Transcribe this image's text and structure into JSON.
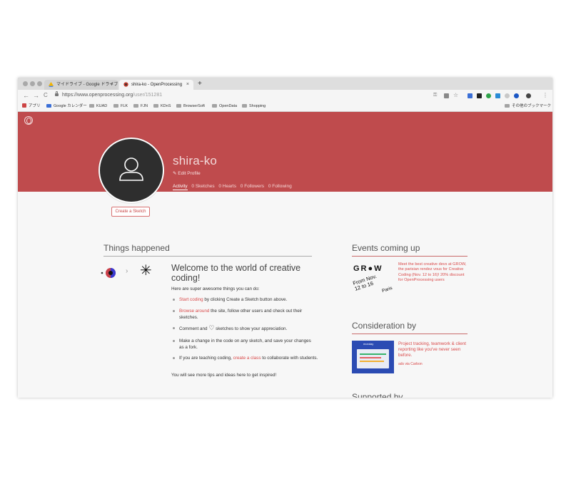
{
  "browser": {
    "tabs": [
      {
        "label": "マイドライブ - Google ドライブ",
        "close": "×"
      },
      {
        "label": "shira-ko - OpenProcessing",
        "close": "×"
      }
    ],
    "new_tab": "+",
    "nav": {
      "back": "←",
      "forward": "→",
      "reload": "C"
    },
    "url_main": "https://www.openprocessing.org",
    "url_path": "/user/151281",
    "bookmarks": [
      "アプリ",
      "Google カレンダー",
      "KUAD",
      "FLK",
      "FJN",
      "KDnS",
      "BrowserSoft",
      "OpenData",
      "Shopping"
    ],
    "bookmarks_other": "その他のブックマーク"
  },
  "profile": {
    "username": "shira-ko",
    "edit_label": "Edit Profile",
    "tabs": [
      "Activity",
      "0 Sketches",
      "0 Hearts",
      "0 Followers",
      "0 Following"
    ],
    "create_button": "Create a Sketch"
  },
  "activity": {
    "heading": "Things happened",
    "arrow": "›",
    "star": "✳",
    "welcome_title": "Welcome to the world of creative coding!",
    "intro": "Here are super awesome things you can do:",
    "items": [
      {
        "link": "Start coding",
        "rest": " by clicking Create a Sketch button above."
      },
      {
        "link": "Browse around",
        "rest": " the site, follow other users and check out their sketches."
      },
      {
        "pre": "Comment and ",
        "heart": "♡",
        "rest": " sketches to show your appreciation."
      },
      {
        "text": "Make a change in the code on any sketch, and save your changes as a fork."
      },
      {
        "pre": "If you are teaching coding, ",
        "link": "create a class",
        "rest": " to collaborate with students."
      }
    ],
    "outro": "You will see more tips and ideas here to get inspired!"
  },
  "sidebar": {
    "events_heading": "Events coming up",
    "event": {
      "logo_word": "GR●W",
      "logo_dates": "From Nov. 12 to 16",
      "logo_city": "Paris",
      "text": "Meet the best creative devs at GROW, the parisian rendez vous for Creative Coding (Nov. 12 to 16)! 20% discount for OpenProcessing users"
    },
    "consideration_heading": "Consideration by",
    "ad": {
      "brand": "monday",
      "text": "Project tracking, teamwork & client reporting like you've never seen before.",
      "via": "ads via Carbon"
    },
    "supported_heading": "Supported by"
  },
  "colors": {
    "banner": "#bf4b4d",
    "accent": "#d94a4a",
    "ad_bg": "#2b4bb3"
  }
}
